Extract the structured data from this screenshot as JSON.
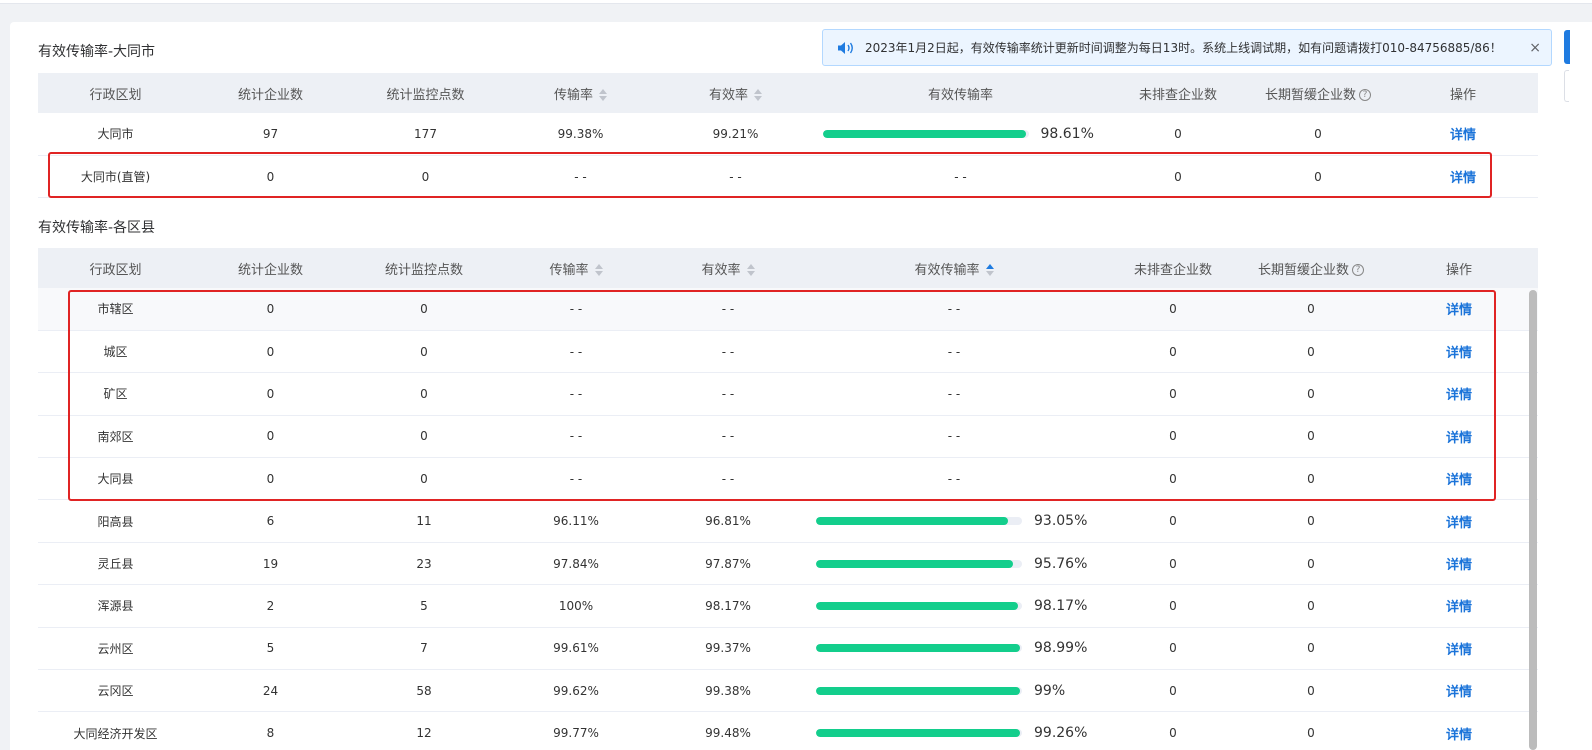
{
  "notice": {
    "text": "2023年1月2日起，有效传输率统计更新时间调整为每日13时。系统上线调试期，如有问题请拨打010-84756885/86！",
    "close": "×"
  },
  "city_section": {
    "title": "有效传输率-大同市",
    "headers": [
      "行政区划",
      "统计企业数",
      "统计监控点数",
      "传输率",
      "有效率",
      "有效传输率",
      "未排查企业数",
      "长期暂缓企业数",
      "操作"
    ],
    "rows": [
      {
        "name": "大同市",
        "companies": "97",
        "points": "177",
        "trans": "99.38%",
        "valid": "99.21%",
        "eff": "98.61%",
        "eff_value": 98.61,
        "unchecked": "0",
        "deferred": "0",
        "action": "详情"
      },
      {
        "name": "大同市(直管)",
        "companies": "0",
        "points": "0",
        "trans": "- -",
        "valid": "- -",
        "eff": "- -",
        "eff_value": null,
        "unchecked": "0",
        "deferred": "0",
        "action": "详情"
      }
    ]
  },
  "county_section": {
    "title": "有效传输率-各区县",
    "headers": [
      "行政区划",
      "统计企业数",
      "统计监控点数",
      "传输率",
      "有效率",
      "有效传输率",
      "未排查企业数",
      "长期暂缓企业数",
      "操作"
    ],
    "rows": [
      {
        "name": "市辖区",
        "companies": "0",
        "points": "0",
        "trans": "- -",
        "valid": "- -",
        "eff": "- -",
        "eff_value": null,
        "unchecked": "0",
        "deferred": "0",
        "action": "详情"
      },
      {
        "name": "城区",
        "companies": "0",
        "points": "0",
        "trans": "- -",
        "valid": "- -",
        "eff": "- -",
        "eff_value": null,
        "unchecked": "0",
        "deferred": "0",
        "action": "详情"
      },
      {
        "name": "矿区",
        "companies": "0",
        "points": "0",
        "trans": "- -",
        "valid": "- -",
        "eff": "- -",
        "eff_value": null,
        "unchecked": "0",
        "deferred": "0",
        "action": "详情"
      },
      {
        "name": "南郊区",
        "companies": "0",
        "points": "0",
        "trans": "- -",
        "valid": "- -",
        "eff": "- -",
        "eff_value": null,
        "unchecked": "0",
        "deferred": "0",
        "action": "详情"
      },
      {
        "name": "大同县",
        "companies": "0",
        "points": "0",
        "trans": "- -",
        "valid": "- -",
        "eff": "- -",
        "eff_value": null,
        "unchecked": "0",
        "deferred": "0",
        "action": "详情"
      },
      {
        "name": "阳高县",
        "companies": "6",
        "points": "11",
        "trans": "96.11%",
        "valid": "96.81%",
        "eff": "93.05%",
        "eff_value": 93.05,
        "unchecked": "0",
        "deferred": "0",
        "action": "详情"
      },
      {
        "name": "灵丘县",
        "companies": "19",
        "points": "23",
        "trans": "97.84%",
        "valid": "97.87%",
        "eff": "95.76%",
        "eff_value": 95.76,
        "unchecked": "0",
        "deferred": "0",
        "action": "详情"
      },
      {
        "name": "浑源县",
        "companies": "2",
        "points": "5",
        "trans": "100%",
        "valid": "98.17%",
        "eff": "98.17%",
        "eff_value": 98.17,
        "unchecked": "0",
        "deferred": "0",
        "action": "详情"
      },
      {
        "name": "云州区",
        "companies": "5",
        "points": "7",
        "trans": "99.61%",
        "valid": "99.37%",
        "eff": "98.99%",
        "eff_value": 98.99,
        "unchecked": "0",
        "deferred": "0",
        "action": "详情"
      },
      {
        "name": "云冈区",
        "companies": "24",
        "points": "58",
        "trans": "99.62%",
        "valid": "99.38%",
        "eff": "99%",
        "eff_value": 99,
        "unchecked": "0",
        "deferred": "0",
        "action": "详情"
      },
      {
        "name": "大同经济开发区",
        "companies": "8",
        "points": "12",
        "trans": "99.77%",
        "valid": "99.48%",
        "eff": "99.26%",
        "eff_value": 99.26,
        "unchecked": "0",
        "deferred": "0",
        "action": "详情"
      }
    ]
  },
  "colors": {
    "accent": "#1f7be0",
    "bar": "#13ce8c",
    "highlight": "#e02424"
  }
}
